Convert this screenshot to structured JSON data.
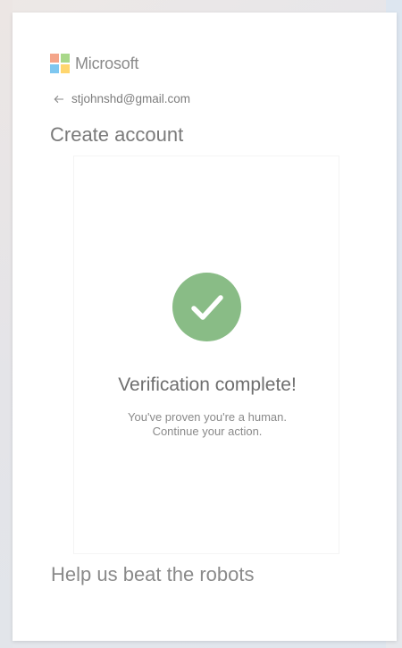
{
  "brand": {
    "name": "Microsoft",
    "logo_colors": [
      "#f4a58a",
      "#a9d88a",
      "#7ec7f0",
      "#ffd66e"
    ]
  },
  "identity": {
    "email": "stjohnshd@gmail.com",
    "back_icon": "arrow-left-icon"
  },
  "page": {
    "title": "Create account"
  },
  "verification": {
    "icon": "checkmark-circle-icon",
    "icon_color": "#89bc86",
    "title": "Verification complete!",
    "line1": "You've proven you're a human.",
    "line2": "Continue your action."
  },
  "footer": {
    "heading": "Help us beat the robots"
  }
}
